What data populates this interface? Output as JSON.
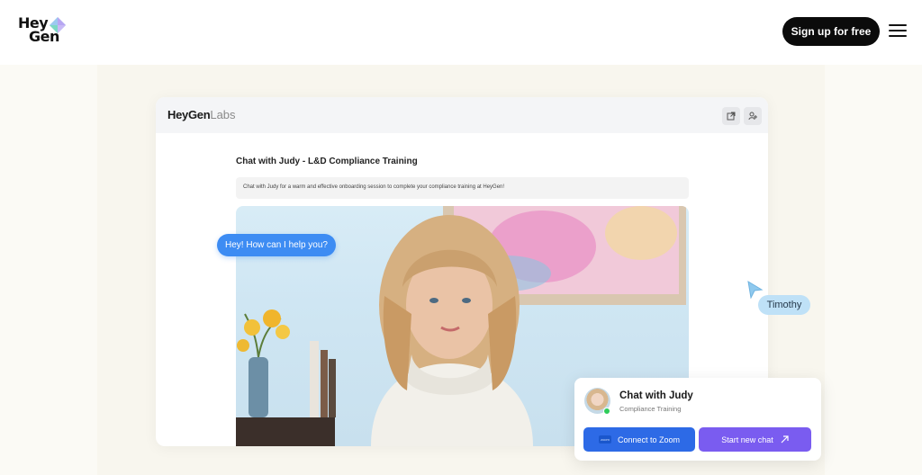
{
  "header": {
    "logo_line1": "Hey",
    "logo_line2": "Gen",
    "signup_label": "Sign up for free"
  },
  "labs": {
    "brand_main": "HeyGen",
    "brand_suffix": "Labs",
    "chat_title": "Chat with Judy - L&D Compliance Training",
    "chat_description": "Chat with Judy for a warm and effective onboarding session to complete your compliance training at HeyGen!"
  },
  "video": {
    "speech_bubble": "Hey! How can I help you?"
  },
  "cursor": {
    "user_name": "Timothy"
  },
  "card": {
    "title": "Chat with Judy",
    "subtitle": "Compliance Training",
    "zoom_label": "Connect to Zoom",
    "zoom_logo": "zoom",
    "new_chat_label": "Start new chat"
  },
  "colors": {
    "accent_blue": "#3d8cf3",
    "zoom_blue": "#2d6ae6",
    "purple": "#7a5cf0",
    "online_green": "#2ecc59"
  }
}
